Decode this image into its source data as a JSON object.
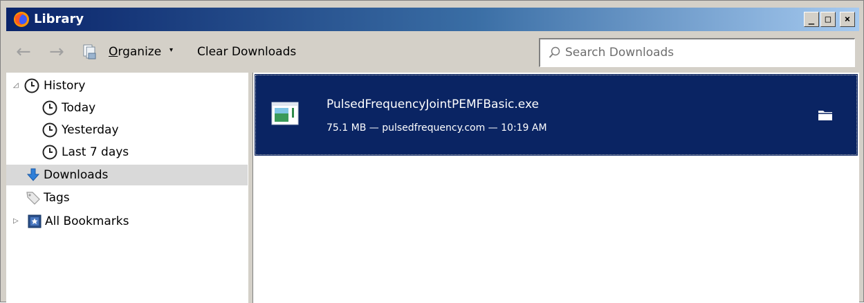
{
  "window": {
    "title": "Library",
    "min_glyph": "_",
    "max_glyph": "□",
    "close_glyph": "×"
  },
  "toolbar": {
    "back_glyph": "←",
    "forward_glyph": "→",
    "organize_label_first": "O",
    "organize_label_rest": "rganize",
    "organize_arrow": "▾",
    "clear_downloads_label": "Clear Downloads",
    "search_placeholder": "Search Downloads",
    "search_value": ""
  },
  "sidebar": {
    "items": [
      {
        "label": "History",
        "icon": "clock-icon",
        "expander": "◿"
      },
      {
        "label": "Today",
        "icon": "clock-icon"
      },
      {
        "label": "Yesterday",
        "icon": "clock-icon"
      },
      {
        "label": "Last 7 days",
        "icon": "clock-icon"
      },
      {
        "label": "Downloads",
        "icon": "download-arrow-icon"
      },
      {
        "label": "Tags",
        "icon": "tag-icon"
      },
      {
        "label": "All Bookmarks",
        "icon": "bookmarks-icon",
        "expander": "▷"
      }
    ]
  },
  "downloads": [
    {
      "file_name": "PulsedFrequencyJointPEMFBasic.exe",
      "meta": "75.1 MB — pulsedfrequency.com — 10:19 AM"
    }
  ],
  "colors": {
    "selection": "#0a2463",
    "titlebar_start": "#0a246a",
    "chrome": "#d4d0c8"
  }
}
